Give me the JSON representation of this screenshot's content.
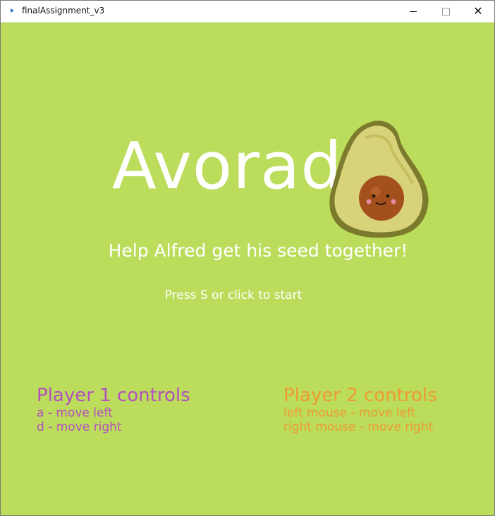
{
  "window": {
    "title": "finalAssignment_v3"
  },
  "colors": {
    "background": "#bbdd5b",
    "player1": "#b44fc0",
    "player2": "#ef9a33",
    "text": "#ffffff"
  },
  "game": {
    "title": "Avorado",
    "subtitle": "Help Alfred get his seed together!",
    "start_prompt": "Press S or click to start"
  },
  "controls": {
    "player1": {
      "heading": "Player 1 controls",
      "left": "a - move left",
      "right": "d - move right"
    },
    "player2": {
      "heading": "Player 2 controls",
      "left": "left mouse - move left",
      "right": "right mouse - move right"
    }
  }
}
